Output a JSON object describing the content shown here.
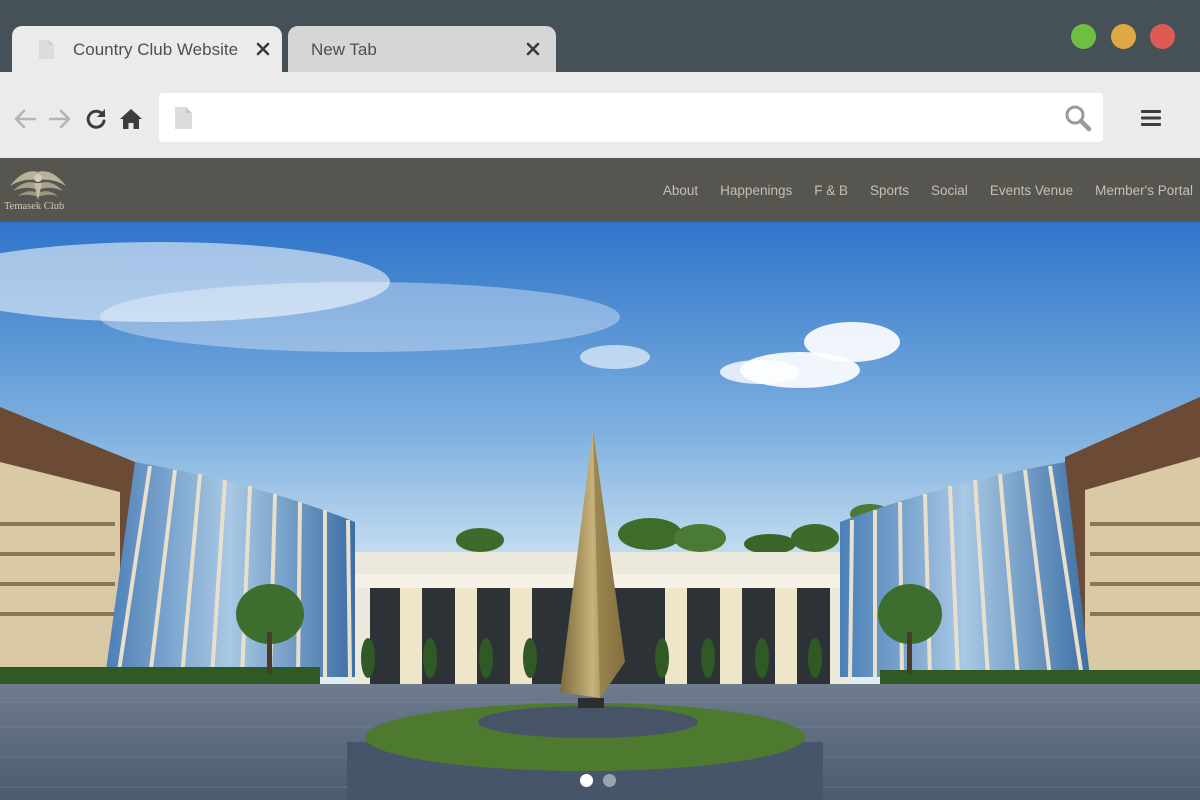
{
  "browser": {
    "tabs": [
      {
        "label": "Country Club Website",
        "active": true
      },
      {
        "label": "New Tab",
        "active": false
      }
    ],
    "window_controls": {
      "colors": [
        "#6dbe45",
        "#e0a844",
        "#e05a55"
      ]
    },
    "address_bar": {
      "value": "",
      "placeholder": ""
    },
    "icons": {
      "back": "arrow-left-icon",
      "forward": "arrow-right-icon",
      "reload": "reload-icon",
      "home": "home-icon",
      "page": "page-icon",
      "search": "magnifier-icon",
      "menu": "hamburger-icon"
    }
  },
  "site": {
    "logo_text": "Temasek Club",
    "nav": [
      "About",
      "Happenings",
      "F & B",
      "Sports",
      "Social",
      "Events Venue",
      "Member's Portal"
    ],
    "colors": {
      "nav_bg": "#565550",
      "nav_text": "#c5c1b1"
    }
  },
  "hero": {
    "carousel": {
      "slides": 2,
      "active_index": 0
    }
  }
}
